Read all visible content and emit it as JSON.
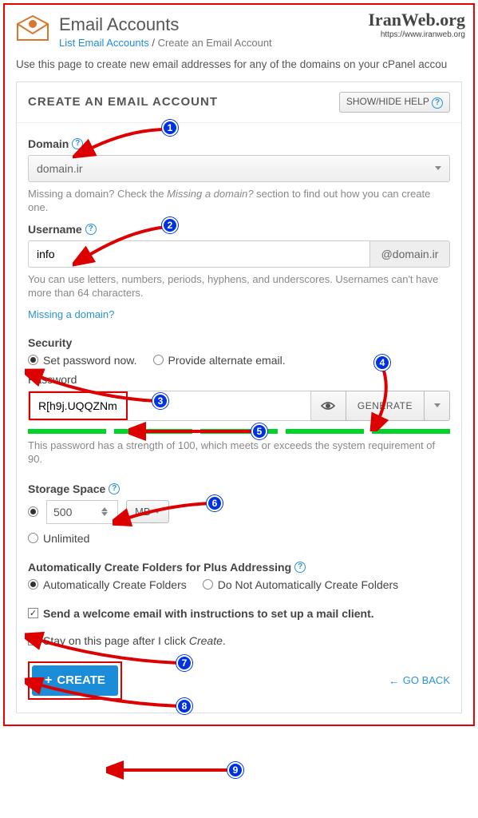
{
  "watermark": {
    "title": "IranWeb.org",
    "url": "https://www.iranweb.org"
  },
  "header": {
    "title": "Email Accounts",
    "breadcrumb_link": "List Email Accounts",
    "breadcrumb_current": "Create an Email Account"
  },
  "intro": "Use this page to create new email addresses for any of the domains on your cPanel accou",
  "panel": {
    "title": "CREATE AN EMAIL ACCOUNT",
    "show_hide": "SHOW/HIDE HELP",
    "domain": {
      "label": "Domain",
      "value": "domain.ir",
      "helper": "Missing a domain? Check the Missing a domain? section to find out how you can create one."
    },
    "username": {
      "label": "Username",
      "value": "info",
      "suffix": "@domain.ir",
      "helper": "You can use letters, numbers, periods, hyphens, and underscores. Usernames can't have more than 64 characters.",
      "missing_link": "Missing a domain?"
    },
    "security": {
      "label": "Security",
      "opt_now": "Set password now.",
      "opt_alt": "Provide alternate email.",
      "password_label": "Password",
      "password_value": "R[h9j.UQQZNm",
      "generate": "GENERATE",
      "strength_msg": "This password has a strength of 100, which meets or exceeds the system requirement of 90."
    },
    "storage": {
      "label": "Storage Space",
      "value": "500",
      "unit": "MB",
      "unlimited": "Unlimited"
    },
    "folders": {
      "label": "Automatically Create Folders for Plus Addressing",
      "opt_auto": "Automatically Create Folders",
      "opt_no": "Do Not Automatically Create Folders"
    },
    "welcome": "Send a welcome email with instructions to set up a mail client.",
    "stay": "Stay on this page after I click Create.",
    "create": "CREATE",
    "go_back": "GO BACK"
  },
  "badges": [
    "1",
    "2",
    "3",
    "4",
    "5",
    "6",
    "7",
    "8",
    "9"
  ]
}
